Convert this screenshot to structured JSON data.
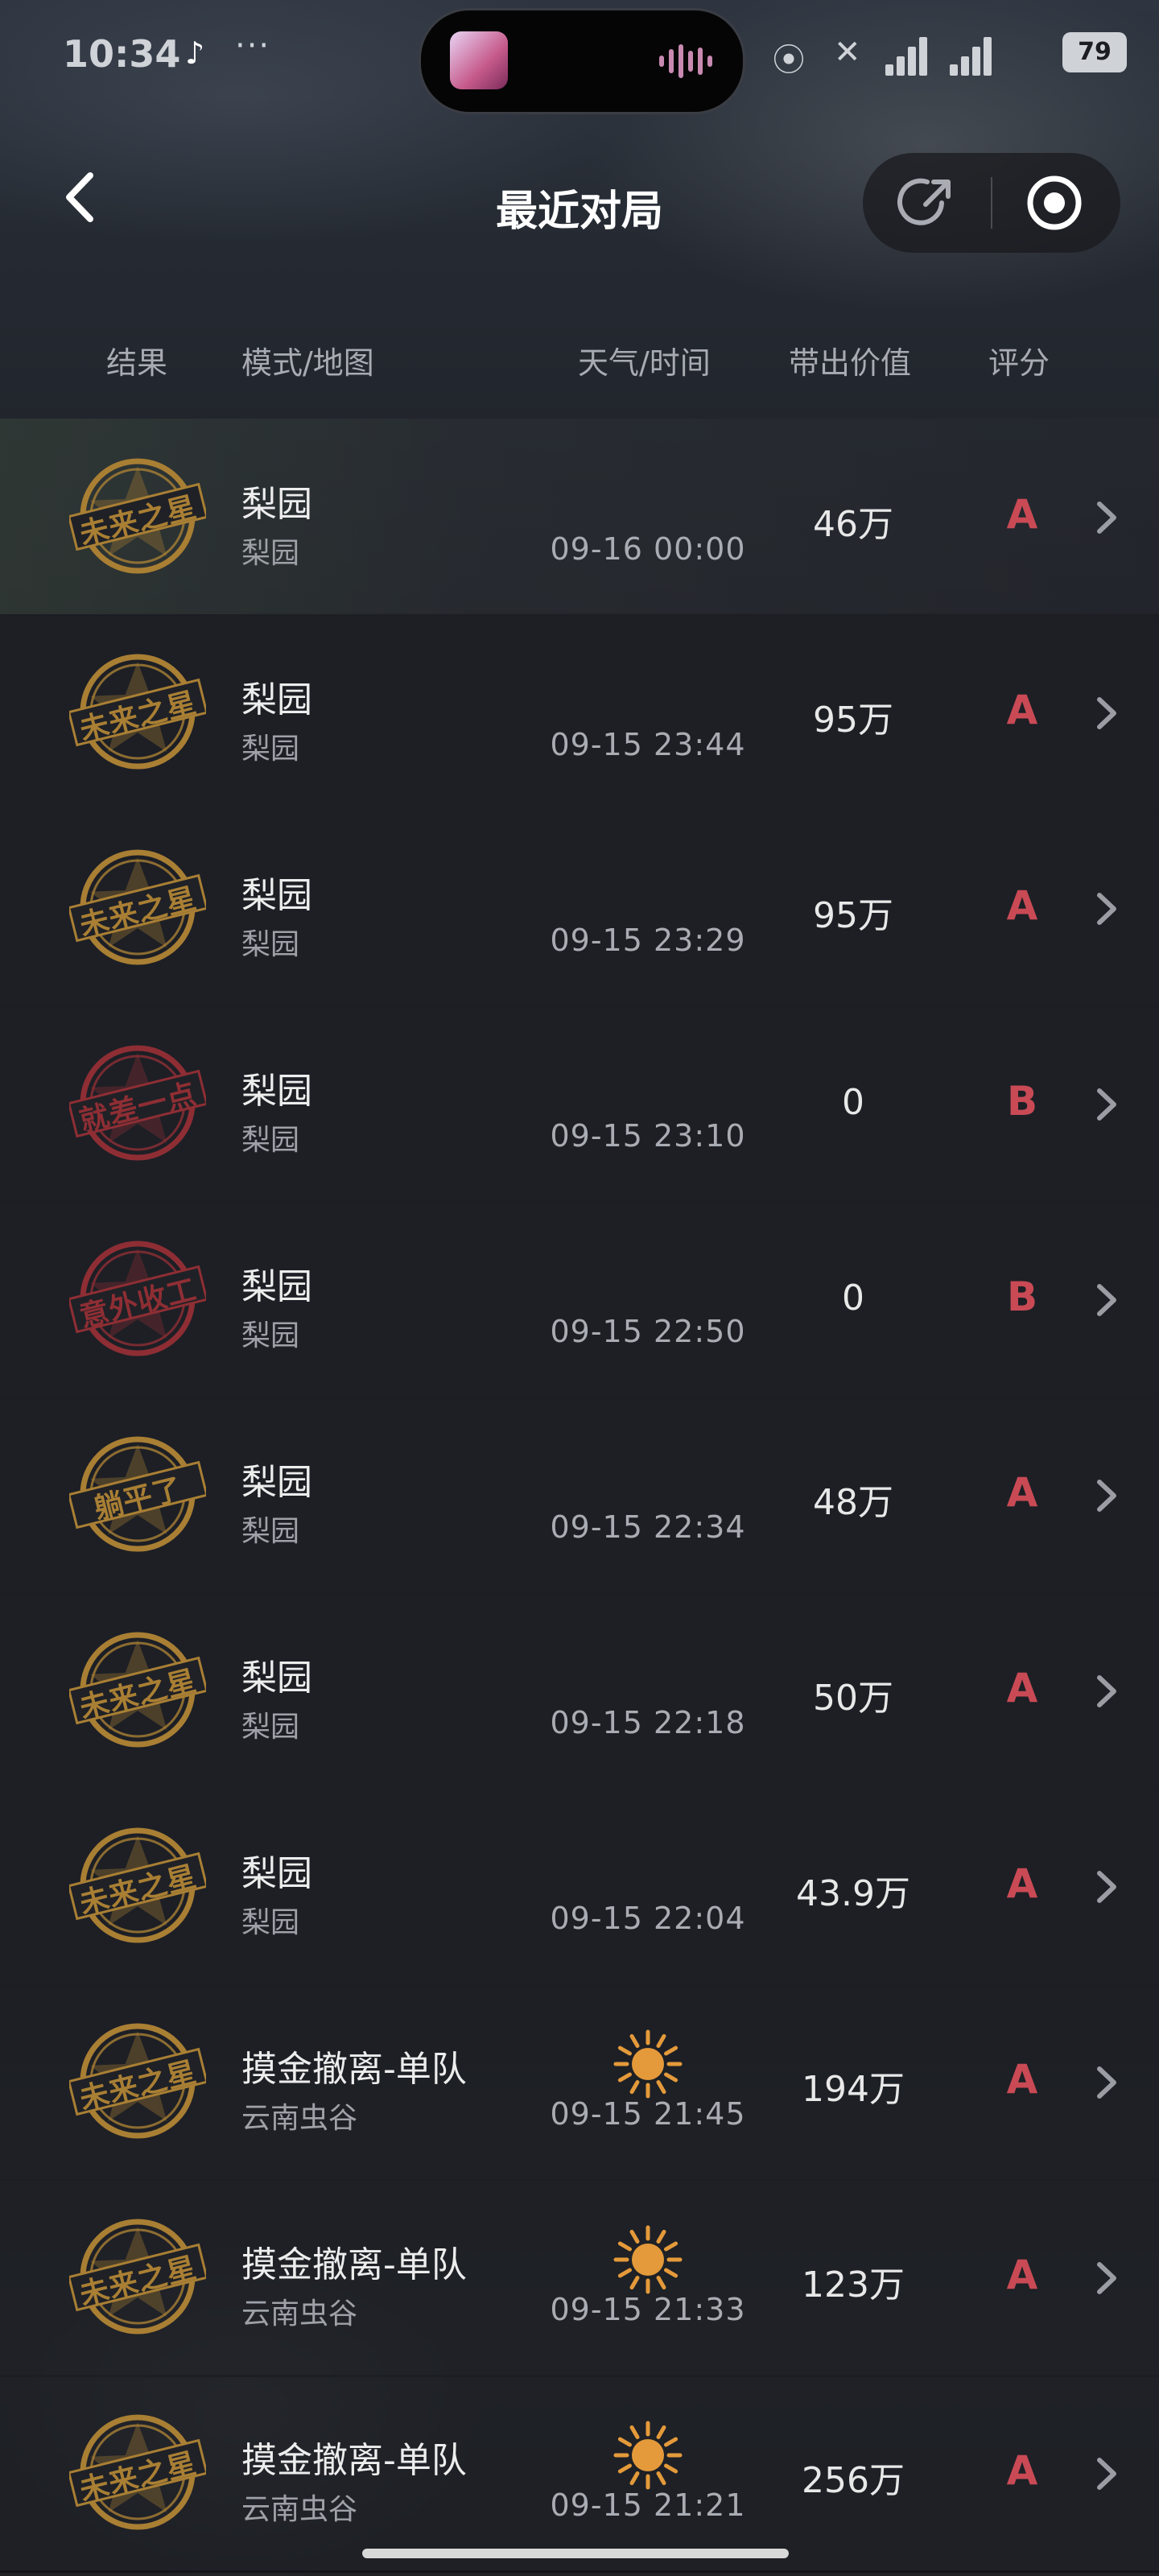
{
  "status_bar": {
    "time": "10:34",
    "app_icon": "tiktok-icon",
    "dots": "···",
    "battery": "79"
  },
  "header": {
    "title": "最近对局",
    "back_icon": "chevron-left-icon",
    "share_icon": "share-icon",
    "close_icon": "record-circle-icon"
  },
  "columns": {
    "result": "结果",
    "mode_map": "模式/地图",
    "weather_time": "天气/时间",
    "value": "带出价值",
    "score": "评分"
  },
  "colors": {
    "gold": "#a97f34",
    "red": "#8e2e34",
    "score_red": "#c94a55",
    "sun": "#e49a3a"
  },
  "matches": [
    {
      "badge": "未来之星",
      "badge_color": "gold",
      "mode": "梨园",
      "map": "梨园",
      "weather": "",
      "time": "09-16 00:00",
      "value": "46万",
      "score": "A"
    },
    {
      "badge": "未来之星",
      "badge_color": "gold",
      "mode": "梨园",
      "map": "梨园",
      "weather": "",
      "time": "09-15 23:44",
      "value": "95万",
      "score": "A"
    },
    {
      "badge": "未来之星",
      "badge_color": "gold",
      "mode": "梨园",
      "map": "梨园",
      "weather": "",
      "time": "09-15 23:29",
      "value": "95万",
      "score": "A"
    },
    {
      "badge": "就差一点",
      "badge_color": "red",
      "mode": "梨园",
      "map": "梨园",
      "weather": "",
      "time": "09-15 23:10",
      "value": "0",
      "score": "B"
    },
    {
      "badge": "意外收工",
      "badge_color": "red",
      "mode": "梨园",
      "map": "梨园",
      "weather": "",
      "time": "09-15 22:50",
      "value": "0",
      "score": "B"
    },
    {
      "badge": "躺平了",
      "badge_color": "gold",
      "mode": "梨园",
      "map": "梨园",
      "weather": "",
      "time": "09-15 22:34",
      "value": "48万",
      "score": "A"
    },
    {
      "badge": "未来之星",
      "badge_color": "gold",
      "mode": "梨园",
      "map": "梨园",
      "weather": "",
      "time": "09-15 22:18",
      "value": "50万",
      "score": "A"
    },
    {
      "badge": "未来之星",
      "badge_color": "gold",
      "mode": "梨园",
      "map": "梨园",
      "weather": "",
      "time": "09-15 22:04",
      "value": "43.9万",
      "score": "A"
    },
    {
      "badge": "未来之星",
      "badge_color": "gold",
      "mode": "摸金撤离-单队",
      "map": "云南虫谷",
      "weather": "sun-icon",
      "time": "09-15 21:45",
      "value": "194万",
      "score": "A"
    },
    {
      "badge": "未来之星",
      "badge_color": "gold",
      "mode": "摸金撤离-单队",
      "map": "云南虫谷",
      "weather": "sun-icon",
      "time": "09-15 21:33",
      "value": "123万",
      "score": "A"
    },
    {
      "badge": "未来之星",
      "badge_color": "gold",
      "mode": "摸金撤离-单队",
      "map": "云南虫谷",
      "weather": "sun-icon",
      "time": "09-15 21:21",
      "value": "256万",
      "score": "A"
    }
  ]
}
